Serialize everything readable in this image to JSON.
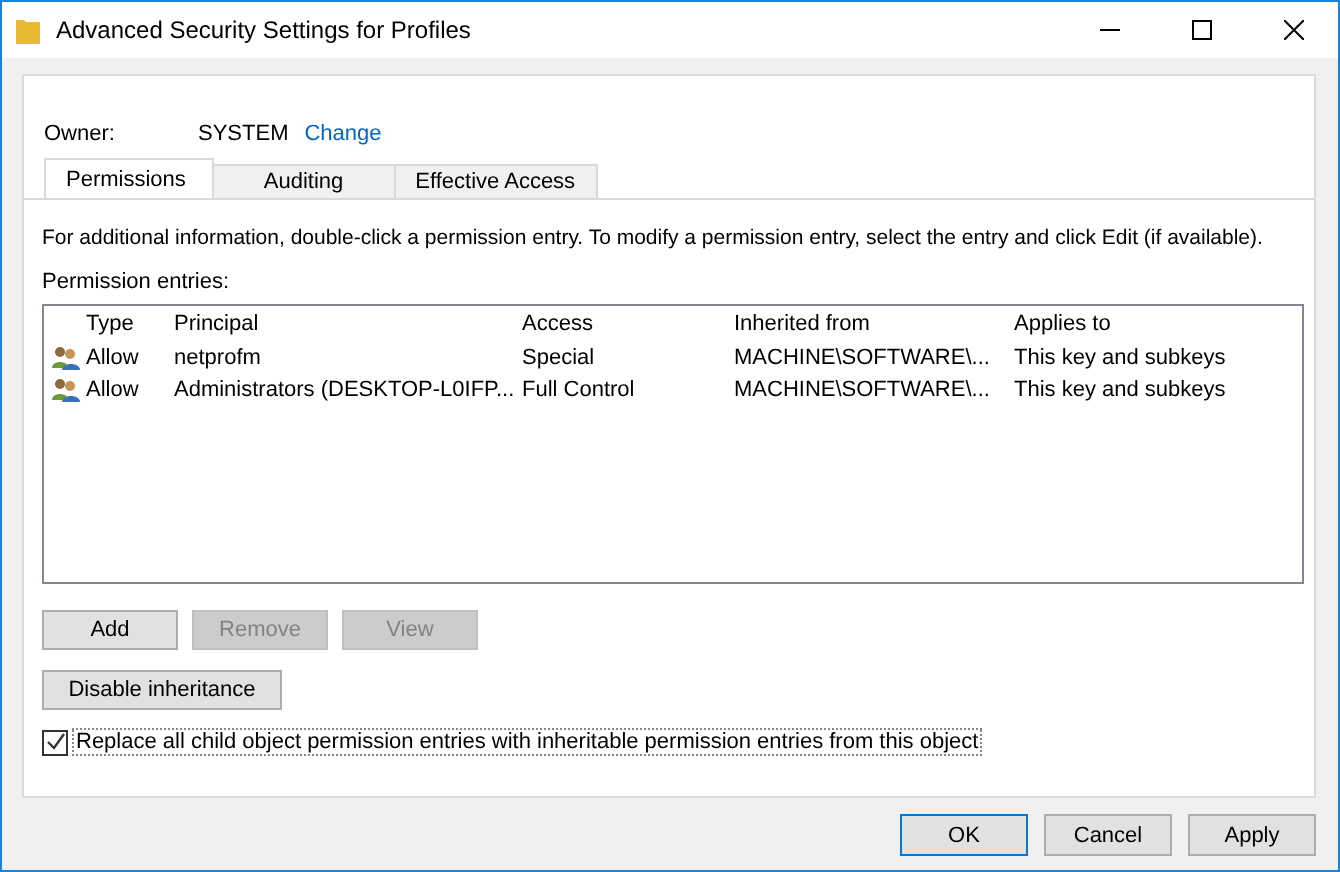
{
  "window": {
    "title": "Advanced Security Settings for Profiles"
  },
  "owner": {
    "label": "Owner:",
    "value": "SYSTEM",
    "link": "Change"
  },
  "tabs": [
    {
      "label": "Permissions",
      "selected": true
    },
    {
      "label": "Auditing",
      "selected": false
    },
    {
      "label": "Effective Access",
      "selected": false
    }
  ],
  "info": "For additional information, double-click a permission entry. To modify a permission entry, select the entry and click Edit (if available).",
  "entries_label": "Permission entries:",
  "table": {
    "columns": [
      "Type",
      "Principal",
      "Access",
      "Inherited from",
      "Applies to"
    ],
    "rows": [
      {
        "cells": [
          "Allow",
          "netprofm",
          "Special",
          "MACHINE\\SOFTWARE\\...",
          "This key and subkeys"
        ],
        "selected": false
      },
      {
        "cells": [
          "Allow",
          "Administrators (DESKTOP-L0IFP...",
          "Full Control",
          "MACHINE\\SOFTWARE\\...",
          "This key and subkeys"
        ],
        "selected": false
      }
    ]
  },
  "entry_buttons": [
    {
      "label": "Add",
      "disabled": false
    },
    {
      "label": "Remove",
      "disabled": true
    },
    {
      "label": "View",
      "disabled": true
    }
  ],
  "inheritance_button": "Disable inheritance",
  "replace_checkbox": {
    "label": "Replace all child object permission entries with inheritable permission entries from this object",
    "checked": true
  },
  "buttons": [
    {
      "label": "OK",
      "default": true
    },
    {
      "label": "Cancel",
      "default": false
    },
    {
      "label": "Apply",
      "default": false
    }
  ]
}
